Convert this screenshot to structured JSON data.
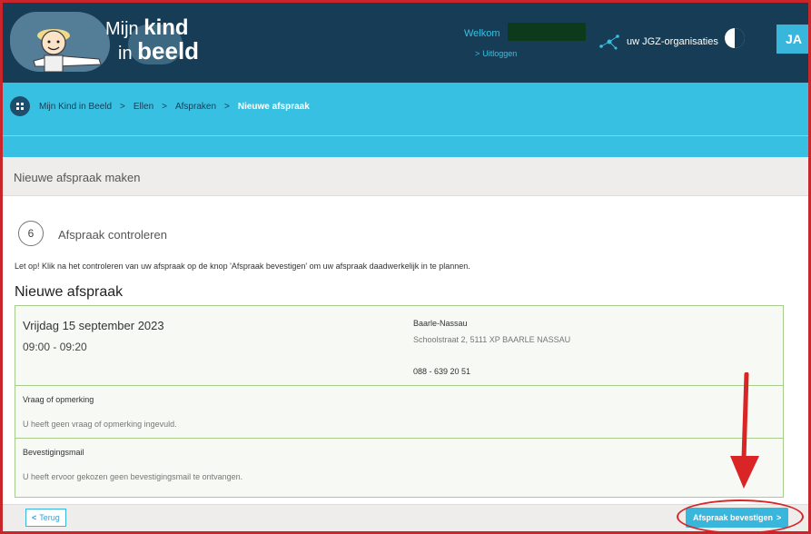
{
  "header": {
    "logo_line1_prefix": "Mijn",
    "logo_line1_bold": "kind",
    "logo_line2_prefix": "in",
    "logo_line2_bold": "beeld",
    "welcome_label": "Welkom",
    "logout_label": "Uitloggen",
    "organisations_label": "uw JGZ-organisaties",
    "person_button_label": "JA"
  },
  "breadcrumb": {
    "items": [
      "Mijn Kind in Beeld",
      "Ellen",
      "Afspraken"
    ],
    "current": "Nieuwe afspraak",
    "separator": ">"
  },
  "page": {
    "title": "Nieuwe afspraak maken"
  },
  "step": {
    "number": "6",
    "label": "Afspraak controleren",
    "notice": "Let op! Klik na het controleren van uw afspraak op de knop 'Afspraak bevestigen' om uw afspraak daadwerkelijk in te plannen."
  },
  "appointment": {
    "section_title": "Nieuwe afspraak",
    "date": "Vrijdag 15 september 2023",
    "time": "09:00 - 09:20",
    "location_name": "Baarle-Nassau",
    "location_address": "Schoolstraat 2, 5111 XP BAARLE NASSAU",
    "location_phone": "088 - 639 20 51",
    "question_heading": "Vraag of opmerking",
    "question_value": "U heeft geen vraag of opmerking ingevuld.",
    "mail_heading": "Bevestigingsmail",
    "mail_value": "U heeft ervoor gekozen geen bevestigingsmail te ontvangen."
  },
  "footer": {
    "back_label": "Terug",
    "confirm_label": "Afspraak bevestigen"
  },
  "colors": {
    "header_bg": "#163d55",
    "accent": "#38c0e2",
    "card_border": "#a9cc8e",
    "annotation_red": "#d92525"
  },
  "icons": {
    "menu": "grid-icon",
    "organisations": "network-icon",
    "contrast": "contrast-icon",
    "person": "person-icon"
  }
}
